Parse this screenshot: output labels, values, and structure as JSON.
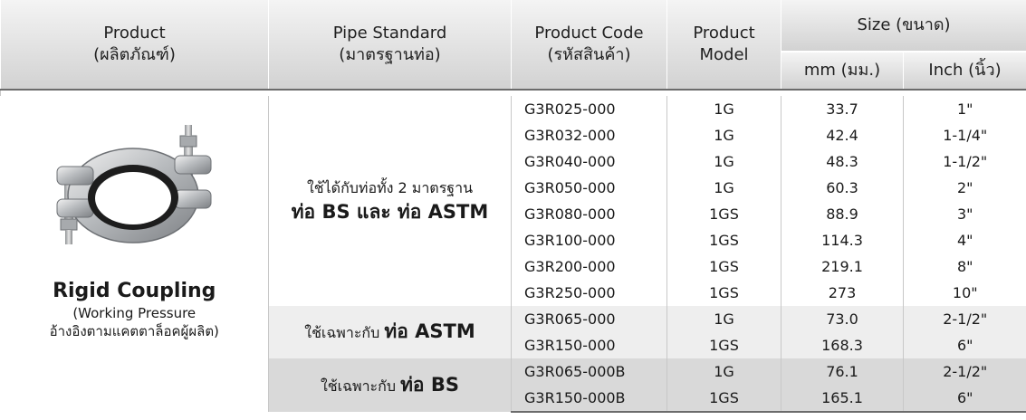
{
  "header": {
    "product": "Product",
    "product_th": "(ผลิตภัณฑ์)",
    "pipe_standard": "Pipe Standard",
    "pipe_standard_th": "(มาตรฐานท่อ)",
    "product_code": "Product Code",
    "product_code_th": "(รหัสสินค้า)",
    "product_model_line1": "Product",
    "product_model_line2": "Model",
    "size": "Size (ขนาด)",
    "mm": "mm (มม.)",
    "inch": "Inch (นิ้ว)"
  },
  "product": {
    "name": "Rigid Coupling",
    "note_line1": "(Working Pressure",
    "note_line2": "อ้างอิงตามแคตตาล็อคผู้ผลิต)",
    "image_icon": "grooved-coupling-icon"
  },
  "standards": {
    "both_line1": "ใช้ได้กับท่อทั้ง 2 มาตรฐาน",
    "both_line2": "ท่อ BS และ ท่อ ASTM",
    "astm_prefix": "ใช้เฉพาะกับ",
    "astm_bold": "ท่อ ASTM",
    "bs_prefix": "ใช้เฉพาะกับ",
    "bs_bold": "ท่อ BS"
  },
  "groups": [
    {
      "rows": [
        {
          "code": "G3R025-000",
          "model": "1G",
          "mm": "33.7",
          "inch": "1\""
        },
        {
          "code": "G3R032-000",
          "model": "1G",
          "mm": "42.4",
          "inch": "1-1/4\""
        },
        {
          "code": "G3R040-000",
          "model": "1G",
          "mm": "48.3",
          "inch": "1-1/2\""
        },
        {
          "code": "G3R050-000",
          "model": "1G",
          "mm": "60.3",
          "inch": "2\""
        },
        {
          "code": "G3R080-000",
          "model": "1GS",
          "mm": "88.9",
          "inch": "3\""
        },
        {
          "code": "G3R100-000",
          "model": "1GS",
          "mm": "114.3",
          "inch": "4\""
        },
        {
          "code": "G3R200-000",
          "model": "1GS",
          "mm": "219.1",
          "inch": "8\""
        },
        {
          "code": "G3R250-000",
          "model": "1GS",
          "mm": "273",
          "inch": "10\""
        }
      ]
    },
    {
      "rows": [
        {
          "code": "G3R065-000",
          "model": "1G",
          "mm": "73.0",
          "inch": "2-1/2\""
        },
        {
          "code": "G3R150-000",
          "model": "1GS",
          "mm": "168.3",
          "inch": "6\""
        }
      ]
    },
    {
      "rows": [
        {
          "code": "G3R065-000B",
          "model": "1G",
          "mm": "76.1",
          "inch": "2-1/2\""
        },
        {
          "code": "G3R150-000B",
          "model": "1GS",
          "mm": "165.1",
          "inch": "6\""
        }
      ]
    }
  ],
  "colors": {
    "header_top": "#f4f4f4",
    "header_bottom": "#d2d2d2",
    "group_astm": "#eeeeee",
    "group_bs": "#d9d9d9",
    "rule": "#6b6b6b"
  }
}
